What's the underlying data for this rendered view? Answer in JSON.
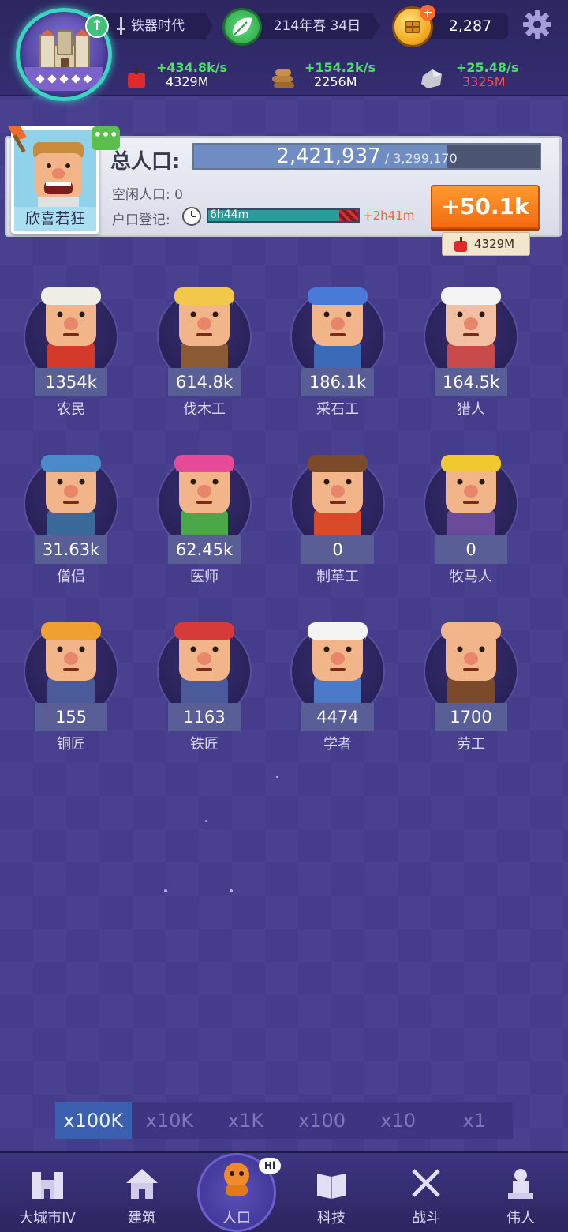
{
  "header": {
    "era": "铁器时代",
    "date": "214年春 34日",
    "coins": "2,287",
    "resources": [
      {
        "name": "food-icon",
        "rate": "+434.8k/s",
        "amount": "4329M",
        "amount_low": false
      },
      {
        "name": "wood-icon",
        "rate": "+154.2k/s",
        "amount": "2256M",
        "amount_low": false
      },
      {
        "name": "stone-icon",
        "rate": "+25.48/s",
        "amount": "3325M",
        "amount_low": true
      }
    ]
  },
  "population": {
    "label": "总人口:",
    "current": "2,421,937",
    "max": "/ 3,299,170",
    "fill_ratio": 0.734,
    "idle": "空闲人口: 0",
    "registration_label": "户口登记:",
    "registration_time": "6h44m",
    "registration_bonus": "+2h41m",
    "registration_fill": 0.88,
    "mood": "欣喜若狂",
    "boost_button": "+50.1k",
    "boost_cost": "4329M"
  },
  "workers": [
    {
      "name": "农民",
      "count": "1354k",
      "icon": "farmer-icon"
    },
    {
      "name": "伐木工",
      "count": "614.8k",
      "icon": "lumberjack-icon"
    },
    {
      "name": "采石工",
      "count": "186.1k",
      "icon": "quarryman-icon"
    },
    {
      "name": "猎人",
      "count": "164.5k",
      "icon": "hunter-icon"
    },
    {
      "name": "僧侣",
      "count": "31.63k",
      "icon": "monk-icon"
    },
    {
      "name": "医师",
      "count": "62.45k",
      "icon": "doctor-icon"
    },
    {
      "name": "制革工",
      "count": "0",
      "icon": "tanner-icon"
    },
    {
      "name": "牧马人",
      "count": "0",
      "icon": "horse-herder-icon"
    },
    {
      "name": "铜匠",
      "count": "155",
      "icon": "coppersmith-icon"
    },
    {
      "name": "铁匠",
      "count": "1163",
      "icon": "blacksmith-icon"
    },
    {
      "name": "学者",
      "count": "4474",
      "icon": "scholar-icon"
    },
    {
      "name": "劳工",
      "count": "1700",
      "icon": "laborer-icon"
    }
  ],
  "multipliers": [
    "x100K",
    "x10K",
    "x1K",
    "x100",
    "x10",
    "x1"
  ],
  "active_multiplier": 0,
  "nav": [
    {
      "label": "大城市IV",
      "icon": "castle-icon"
    },
    {
      "label": "建筑",
      "icon": "house-icon"
    },
    {
      "label": "人口",
      "icon": "citizen-icon",
      "badge": "Hi"
    },
    {
      "label": "科技",
      "icon": "book-icon"
    },
    {
      "label": "战斗",
      "icon": "swords-icon"
    },
    {
      "label": "伟人",
      "icon": "statue-icon"
    }
  ],
  "colors": {
    "background": "#453c8c",
    "accent_orange": "#f26a10",
    "rate_green": "#49e06a",
    "low_red": "#ff4b4b",
    "active_tab": "#3c5fb0"
  }
}
